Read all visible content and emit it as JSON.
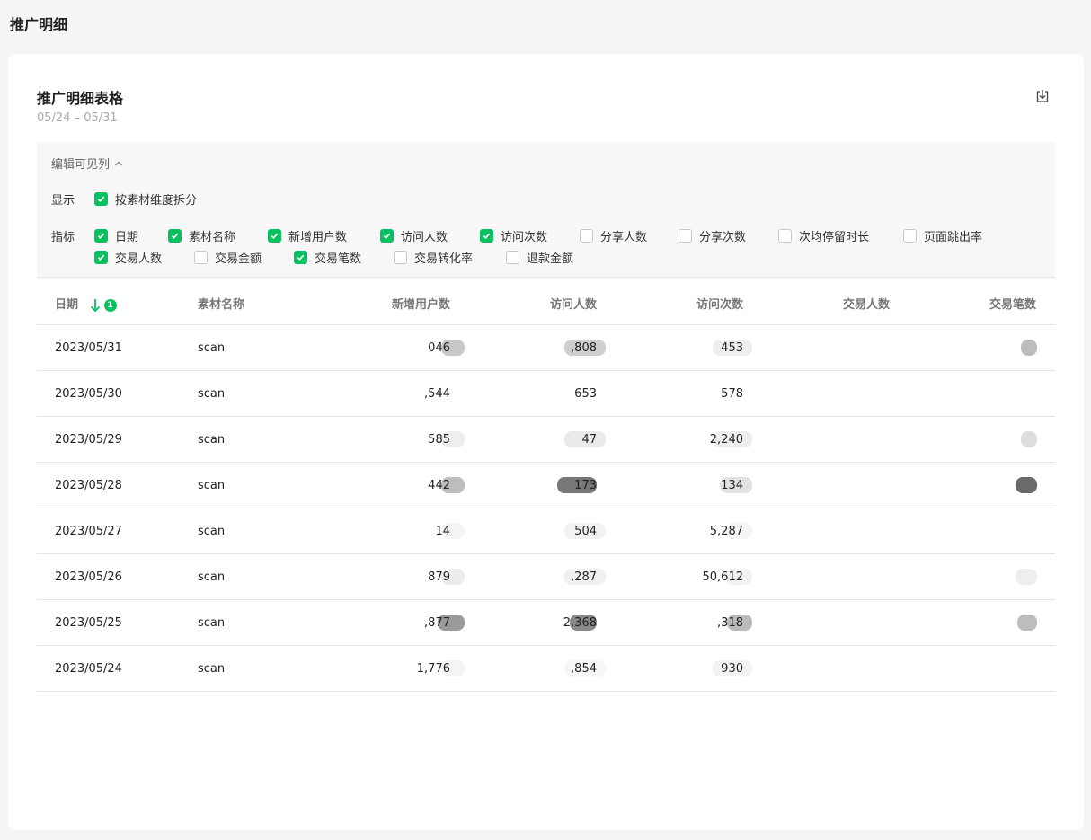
{
  "page": {
    "title": "推广明细"
  },
  "card": {
    "title": "推广明细表格",
    "date_range": "05/24 – 05/31",
    "export_icon": "download-icon"
  },
  "column_editor": {
    "toggle_label": "编辑可见列",
    "display_label": "显示",
    "display_option": {
      "label": "按素材维度拆分",
      "checked": true
    },
    "metrics_label": "指标",
    "metrics": [
      {
        "label": "日期",
        "checked": true
      },
      {
        "label": "素材名称",
        "checked": true
      },
      {
        "label": "新增用户数",
        "checked": true
      },
      {
        "label": "访问人数",
        "checked": true
      },
      {
        "label": "访问次数",
        "checked": true
      },
      {
        "label": "分享人数",
        "checked": false
      },
      {
        "label": "分享次数",
        "checked": false
      },
      {
        "label": "次均停留时长",
        "checked": false
      },
      {
        "label": "页面跳出率",
        "checked": false
      },
      {
        "label": "交易人数",
        "checked": true
      },
      {
        "label": "交易金额",
        "checked": false
      },
      {
        "label": "交易笔数",
        "checked": true
      },
      {
        "label": "交易转化率",
        "checked": false
      },
      {
        "label": "退款金额",
        "checked": false
      }
    ]
  },
  "table": {
    "sort_badge": "1",
    "columns": [
      "日期",
      "素材名称",
      "新增用户数",
      "访问人数",
      "访问次数",
      "交易人数",
      "交易笔数"
    ],
    "rows": [
      {
        "date": "2023/05/31",
        "name": "scan",
        "new_users": "046",
        "visitors": ",808",
        "visits": "453",
        "buyers": "",
        "orders": ""
      },
      {
        "date": "2023/05/30",
        "name": "scan",
        "new_users": ",544",
        "visitors": "653",
        "visits": "578",
        "buyers": "",
        "orders": ""
      },
      {
        "date": "2023/05/29",
        "name": "scan",
        "new_users": "585",
        "visitors": "47",
        "visits": "2,240",
        "buyers": "",
        "orders": ""
      },
      {
        "date": "2023/05/28",
        "name": "scan",
        "new_users": "442",
        "visitors": "173",
        "visits": "134",
        "buyers": "",
        "orders": ""
      },
      {
        "date": "2023/05/27",
        "name": "scan",
        "new_users": "14",
        "visitors": "504",
        "visits": "5,287",
        "buyers": "",
        "orders": ""
      },
      {
        "date": "2023/05/26",
        "name": "scan",
        "new_users": "879",
        "visitors": ",287",
        "visits": "50,612",
        "buyers": "",
        "orders": ""
      },
      {
        "date": "2023/05/25",
        "name": "scan",
        "new_users": ",877",
        "visitors": "2,368",
        "visits": ",318",
        "buyers": "",
        "orders": ""
      },
      {
        "date": "2023/05/24",
        "name": "scan",
        "new_users": "1,776",
        "visitors": ",854",
        "visits": "930",
        "buyers": "",
        "orders": ""
      }
    ]
  },
  "colors": {
    "accent": "#07c160"
  }
}
